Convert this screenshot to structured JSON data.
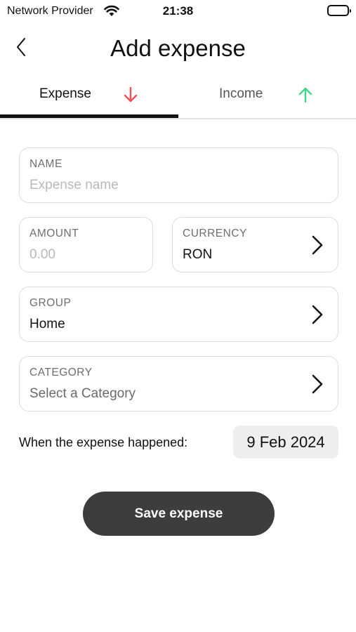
{
  "status_bar": {
    "carrier": "Network Provider",
    "time": "21:38",
    "icons": [
      "wifi-icon",
      "battery-icon"
    ]
  },
  "nav": {
    "title": "Add expense",
    "back_icon": "chevron-left-icon"
  },
  "tabs": [
    {
      "label": "Expense",
      "icon": "arrow-down-icon",
      "icon_color": "#f0505a",
      "selected": true
    },
    {
      "label": "Income",
      "icon": "arrow-up-icon",
      "icon_color": "#3fd68a",
      "selected": false
    }
  ],
  "form": {
    "name": {
      "label": "NAME",
      "placeholder": "Expense name",
      "value": ""
    },
    "amount": {
      "label": "AMOUNT",
      "placeholder": "0.00",
      "value": ""
    },
    "currency": {
      "label": "CURRENCY",
      "value": "RON"
    },
    "group": {
      "label": "GROUP",
      "value": "Home"
    },
    "category": {
      "label": "CATEGORY",
      "value": "Select a Category"
    }
  },
  "date": {
    "label": "When the expense happened:",
    "value": "9 Feb 2024"
  },
  "save_button": {
    "label": "Save expense"
  },
  "colors": {
    "accent_dark": "#3d3d3d",
    "expense_red": "#f0505a",
    "income_green": "#3fd68a",
    "field_border": "#dcdcdc",
    "date_pill_bg": "#eeeeee"
  }
}
